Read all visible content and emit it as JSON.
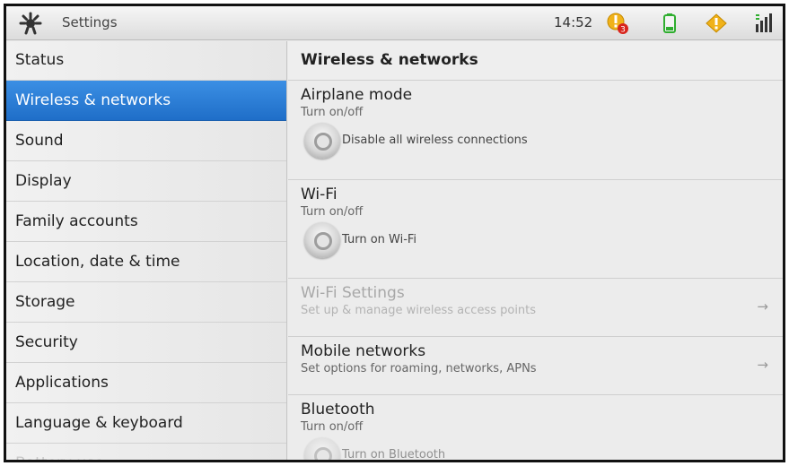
{
  "statusbar": {
    "app_title": "Settings",
    "app_icon": "settings-gear-icon",
    "time": "14:52",
    "notification_badge": "3",
    "icons": [
      "alert-badge-icon",
      "battery-icon",
      "warning-icon",
      "signal-icon"
    ]
  },
  "sidebar": {
    "items": [
      {
        "label": "Status"
      },
      {
        "label": "Wireless & networks",
        "selected": true
      },
      {
        "label": "Sound"
      },
      {
        "label": "Display"
      },
      {
        "label": "Family accounts"
      },
      {
        "label": "Location, date & time"
      },
      {
        "label": "Storage"
      },
      {
        "label": "Security"
      },
      {
        "label": "Applications"
      },
      {
        "label": "Language & keyboard"
      },
      {
        "label": "Battery use"
      }
    ]
  },
  "content": {
    "header": "Wireless & networks",
    "airplane": {
      "title": "Airplane mode",
      "subtitle": "Turn on/off",
      "toggle_label": "Disable all wireless connections"
    },
    "wifi": {
      "title": "Wi-Fi",
      "subtitle": "Turn on/off",
      "toggle_label": "Turn on Wi-Fi"
    },
    "wifi_settings": {
      "title": "Wi-Fi Settings",
      "subtitle": "Set up & manage wireless access points",
      "enabled": false
    },
    "mobile": {
      "title": "Mobile networks",
      "subtitle": "Set options for roaming, networks, APNs"
    },
    "bluetooth": {
      "title": "Bluetooth",
      "subtitle": "Turn on/off",
      "toggle_label": "Turn on Bluetooth"
    }
  },
  "colors": {
    "selected": "#2a7bd6",
    "warning": "#f0b21a"
  }
}
